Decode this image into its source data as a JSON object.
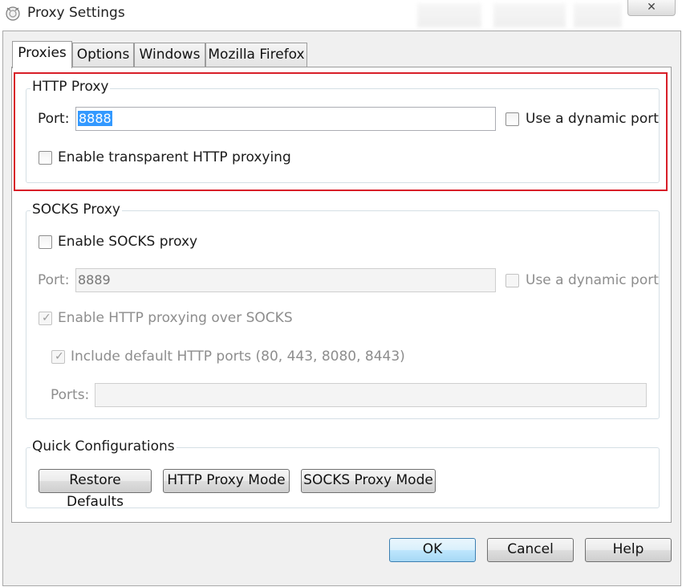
{
  "window": {
    "title": "Proxy Settings",
    "close_glyph": "✕"
  },
  "tabs": [
    {
      "label": "Proxies",
      "active": true
    },
    {
      "label": "Options",
      "active": false
    },
    {
      "label": "Windows",
      "active": false
    },
    {
      "label": "Mozilla Firefox",
      "active": false
    }
  ],
  "http_proxy": {
    "title": "HTTP Proxy",
    "port_label": "Port:",
    "port_value": "8888",
    "dynamic_port_label": "Use a dynamic port",
    "dynamic_port_checked": false,
    "transparent_label": "Enable transparent HTTP proxying",
    "transparent_checked": false
  },
  "socks_proxy": {
    "title": "SOCKS Proxy",
    "enable_label": "Enable SOCKS proxy",
    "enable_checked": false,
    "port_label": "Port:",
    "port_value": "8889",
    "dynamic_port_label": "Use a dynamic port",
    "http_over_socks_label": "Enable HTTP proxying over SOCKS",
    "http_over_socks_checked": true,
    "default_ports_label": "Include default HTTP ports (80, 443, 8080, 8443)",
    "default_ports_checked": true,
    "ports_label": "Ports:",
    "ports_value": ""
  },
  "quick_configurations": {
    "title": "Quick Configurations",
    "restore_defaults": "Restore Defaults",
    "http_proxy_mode": "HTTP Proxy Mode",
    "socks_proxy_mode": "SOCKS Proxy Mode"
  },
  "footer": {
    "ok": "OK",
    "cancel": "Cancel",
    "help": "Help"
  },
  "colors": {
    "highlight": "#d81e28",
    "selection": "#3399ff"
  },
  "icons": {
    "app": "fiddler-icon",
    "checkmark": "✓"
  }
}
